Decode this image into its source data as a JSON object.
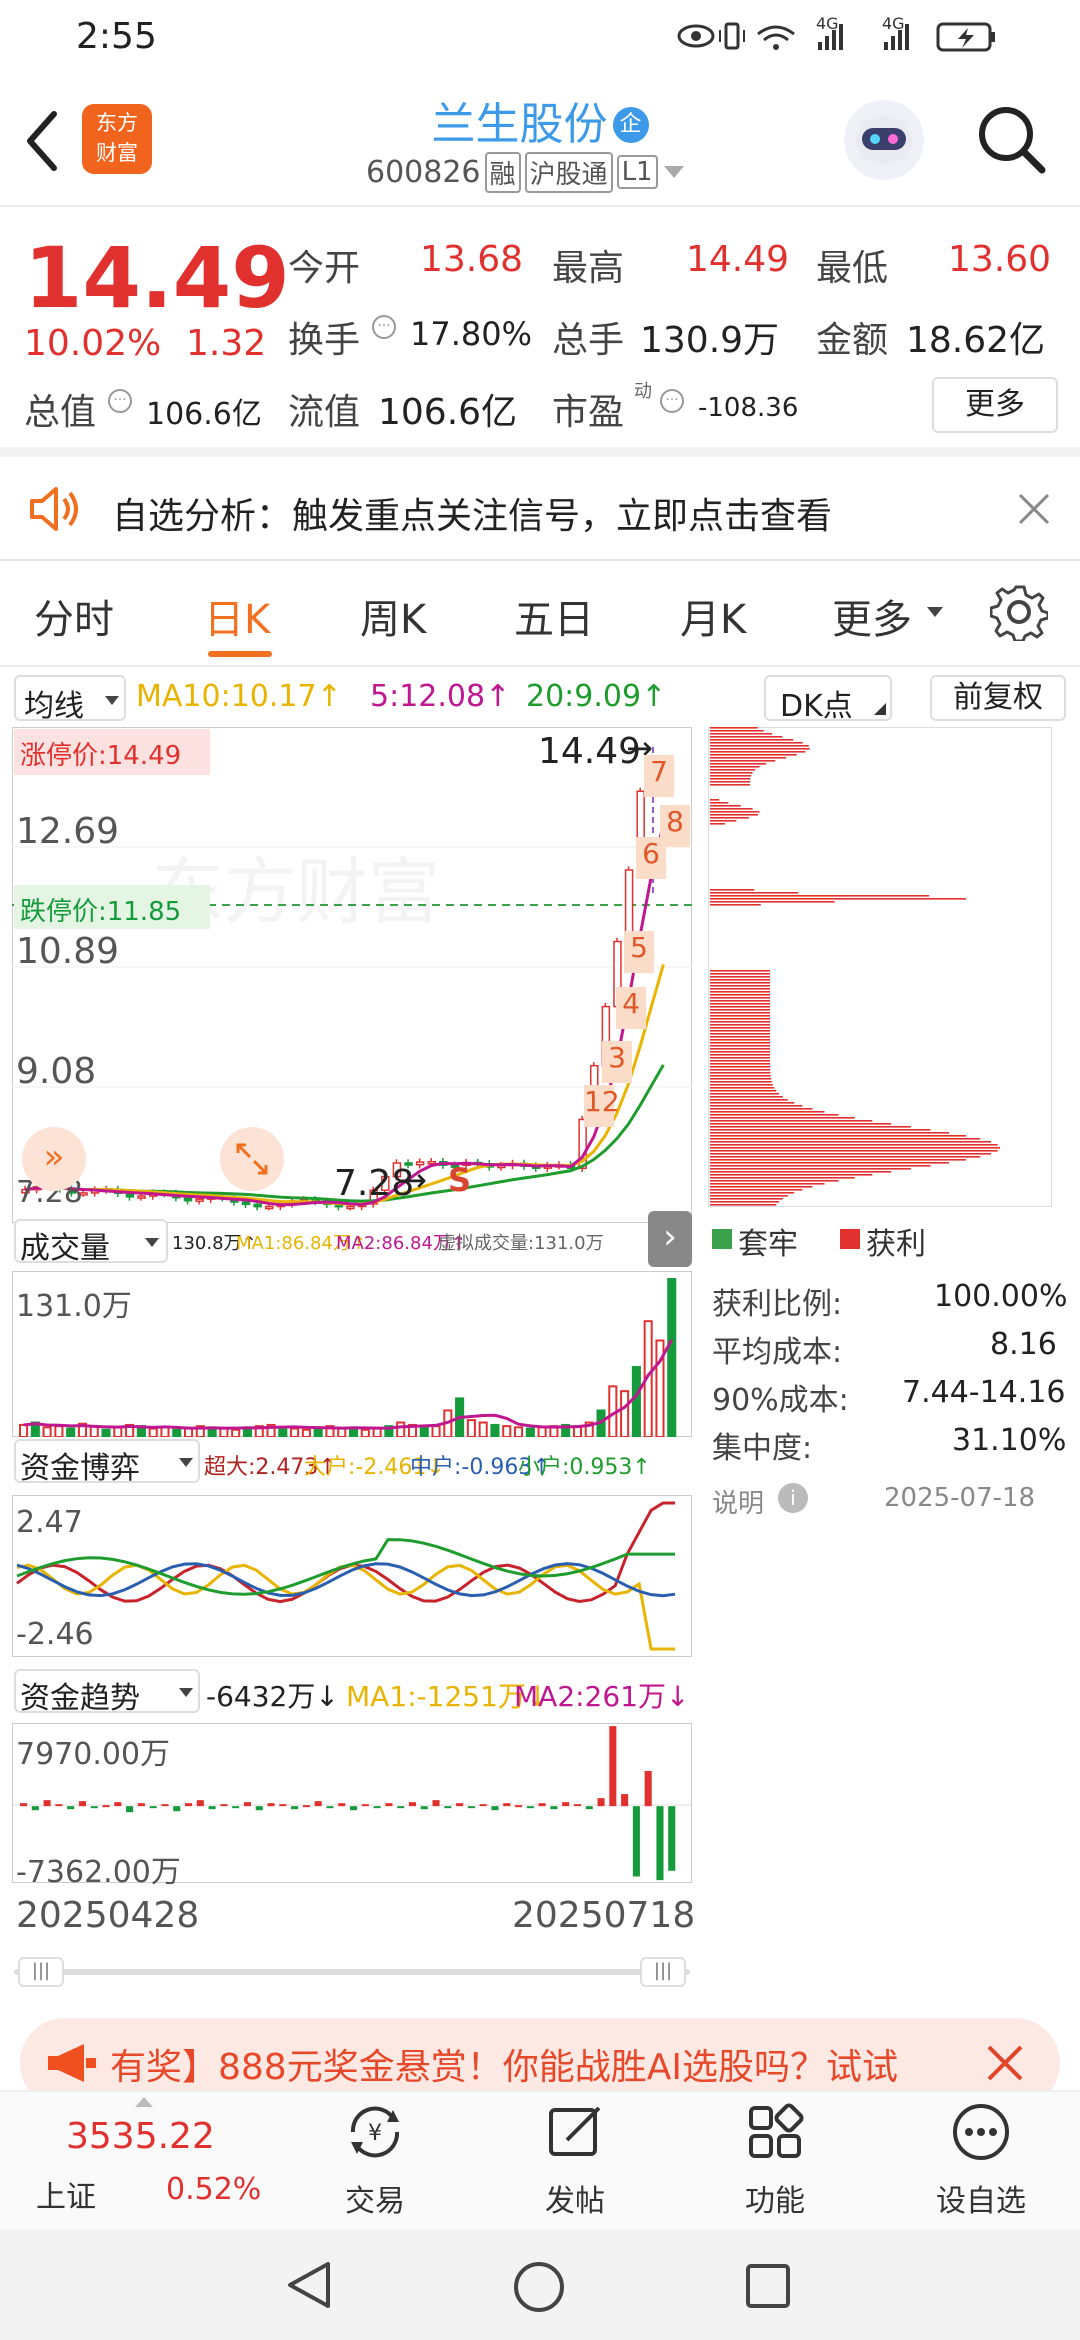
{
  "status": {
    "time": "2:55",
    "net1": "4G",
    "net2": "4G"
  },
  "header": {
    "name": "兰生股份",
    "name_badge": "企",
    "logo_line1": "东方",
    "logo_line2": "财富",
    "code": "600826",
    "tags": [
      "融",
      "沪股通",
      "L1"
    ]
  },
  "quote": {
    "price": "14.49",
    "pct": "10.02%",
    "chg": "1.32",
    "fields": [
      {
        "label": "今开",
        "value": "13.68"
      },
      {
        "label": "最高",
        "value": "14.49"
      },
      {
        "label": "最低",
        "value": "13.60"
      },
      {
        "label": "换手",
        "value": "17.80%"
      },
      {
        "label": "总手",
        "value": "130.9万"
      },
      {
        "label": "金额",
        "value": "18.62亿"
      },
      {
        "label": "总值",
        "value": "106.6亿"
      },
      {
        "label": "流值",
        "value": "106.6亿"
      },
      {
        "label": "市盈",
        "value": "-108.36",
        "sup": "动"
      }
    ],
    "more_label": "更多"
  },
  "notice": {
    "text": "自选分析：触发重点关注信号，立即点击查看"
  },
  "tabs": {
    "items": [
      "分时",
      "日K",
      "周K",
      "五日",
      "月K",
      "更多"
    ],
    "active": 1
  },
  "kline": {
    "ma_selector": "均线",
    "ma10": "MA10:10.17↑",
    "ma5": "5:12.08↑",
    "ma20": "20:9.09↑",
    "dk_label": "DK点",
    "adj_label": "前复权",
    "limit_up": "涨停价:14.49",
    "limit_down": "跌停价:11.85",
    "price_tag": "14.49",
    "low_tag": "7.28",
    "y_labels": [
      "12.69",
      "10.89",
      "9.08",
      "7.28"
    ],
    "streak_labels": [
      "12",
      "3",
      "4",
      "5",
      "6",
      "8",
      "7"
    ],
    "watermark": "东方财富",
    "marker_s": "S"
  },
  "volume": {
    "selector": "成交量",
    "summary": "130.8万↑",
    "ma1": "MA1:86.84万↑",
    "ma2": "MA2:86.84万↑",
    "virtual": "虚拟成交量:131.0万",
    "top": "131.0万"
  },
  "fund_game": {
    "selector": "资金博弈",
    "super": "超大:2.473↑",
    "big": "大户:-2.461↓",
    "mid": "中户:-0.963↑",
    "small": "小户:0.953↑",
    "top": "2.47",
    "bottom": "-2.46"
  },
  "fund_trend": {
    "selector": "资金趋势",
    "value": "-6432万↓",
    "ma1": "MA1:-1251万↓",
    "ma2": "MA2:261万↓",
    "top": "7970.00万",
    "bottom": "-7362.00万"
  },
  "dates": {
    "start": "20250428",
    "end": "20250718"
  },
  "chips": {
    "legend_trap": "套牢",
    "legend_profit": "获利",
    "rows": [
      {
        "label": "获利比例:",
        "value": "100.00%"
      },
      {
        "label": "平均成本:",
        "value": "8.16"
      },
      {
        "label": "90%成本:",
        "value": "7.44-14.16"
      },
      {
        "label": "集中度:",
        "value": "31.10%"
      }
    ],
    "note": "说明",
    "date": "2025-07-18"
  },
  "promo": {
    "text": "有奖】888元奖金悬赏！你能战胜AI选股吗？试试"
  },
  "bottom": {
    "index_value": "3535.22",
    "index_name": "上证",
    "index_pct": "0.52%",
    "items": [
      "交易",
      "发帖",
      "功能",
      "设自选"
    ]
  },
  "colors": {
    "up": "#e0312f",
    "down": "#159a3c",
    "accent": "#f0701f",
    "ma10": "#e8b400",
    "ma5": "#c0168f",
    "ma20": "#1f9c2e"
  },
  "chart_data": [
    {
      "type": "bar",
      "title": "",
      "xlabel": "",
      "ylabel": "",
      "ylim": [
        0,
        131.0
      ],
      "categories": [
        "1",
        "2",
        "3",
        "4",
        "5",
        "6",
        "7",
        "8",
        "9",
        "10",
        "11",
        "12",
        "13",
        "14",
        "15",
        "16",
        "17",
        "18",
        "19",
        "20",
        "21",
        "22",
        "23",
        "24",
        "25",
        "26",
        "27",
        "28",
        "29",
        "30",
        "31",
        "32",
        "33",
        "34",
        "35",
        "36",
        "37",
        "38",
        "39",
        "40",
        "41",
        "42",
        "43",
        "44",
        "45",
        "46",
        "47",
        "48",
        "49",
        "50",
        "51",
        "52",
        "53",
        "54",
        "55",
        "56"
      ],
      "series": [
        {
          "name": "成交量",
          "values": [
            10,
            12,
            8,
            9,
            7,
            11,
            9,
            6,
            8,
            10,
            9,
            7,
            8,
            6,
            7,
            9,
            8,
            7,
            6,
            8,
            9,
            10,
            8,
            7,
            6,
            8,
            9,
            7,
            8,
            6,
            7,
            9,
            12,
            10,
            8,
            9,
            22,
            32,
            14,
            12,
            10,
            9,
            8,
            7,
            8,
            9,
            10,
            9,
            12,
            22,
            42,
            38,
            58,
            96,
            80,
            131
          ]
        }
      ]
    },
    {
      "type": "bar",
      "title": "",
      "xlabel": "",
      "ylabel": "",
      "ylim": [
        -7362,
        7970
      ],
      "categories": [
        "1",
        "2",
        "3",
        "4",
        "5",
        "6",
        "7",
        "8",
        "9",
        "10",
        "11",
        "12",
        "13",
        "14",
        "15",
        "16",
        "17",
        "18",
        "19",
        "20",
        "21",
        "22",
        "23",
        "24",
        "25",
        "26",
        "27",
        "28",
        "29",
        "30",
        "31",
        "32",
        "33",
        "34",
        "35",
        "36",
        "37",
        "38",
        "39",
        "40",
        "41",
        "42",
        "43",
        "44",
        "45",
        "46",
        "47",
        "48",
        "49",
        "50",
        "51",
        "52",
        "53",
        "54",
        "55",
        "56"
      ],
      "series": [
        {
          "name": "资金趋势",
          "values": [
            300,
            -400,
            600,
            200,
            -300,
            500,
            -200,
            100,
            400,
            -600,
            300,
            -100,
            200,
            -500,
            300,
            600,
            -300,
            200,
            -100,
            400,
            -400,
            300,
            200,
            -300,
            100,
            500,
            -200,
            300,
            -400,
            200,
            -100,
            300,
            -200,
            400,
            -300,
            600,
            -200,
            300,
            -100,
            200,
            -400,
            300,
            100,
            -200,
            300,
            -300,
            400,
            200,
            -300,
            800,
            7970,
            1200,
            -7000,
            3500,
            -7362,
            -6432
          ]
        }
      ]
    }
  ]
}
